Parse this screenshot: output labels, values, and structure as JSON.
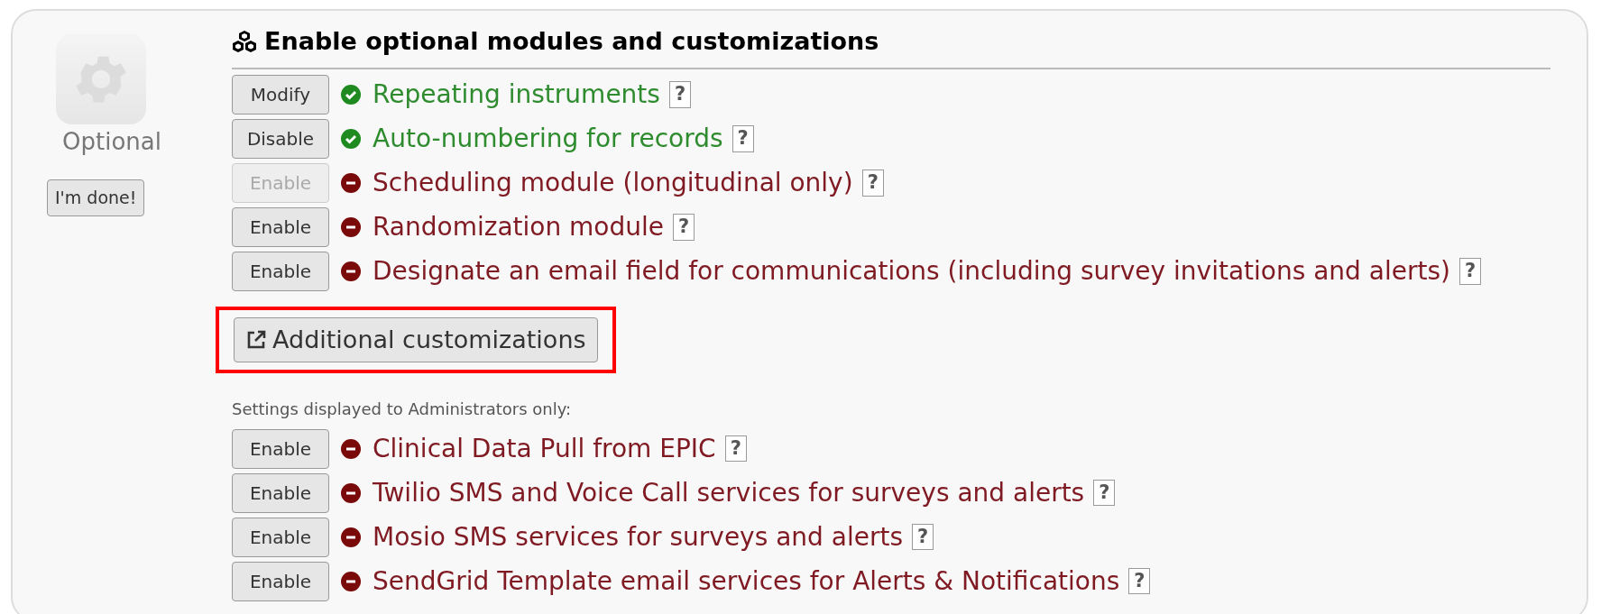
{
  "sidebar": {
    "label": "Optional",
    "done_button": "I'm done!"
  },
  "heading": "Enable optional modules and customizations",
  "modules": [
    {
      "button": "Modify",
      "button_disabled": false,
      "enabled": true,
      "label": "Repeating instruments",
      "help": "?"
    },
    {
      "button": "Disable",
      "button_disabled": false,
      "enabled": true,
      "label": "Auto-numbering for records",
      "help": "?"
    },
    {
      "button": "Enable",
      "button_disabled": true,
      "enabled": false,
      "label": "Scheduling module (longitudinal only)",
      "help": "?"
    },
    {
      "button": "Enable",
      "button_disabled": false,
      "enabled": false,
      "label": "Randomization module",
      "help": "?"
    },
    {
      "button": "Enable",
      "button_disabled": false,
      "enabled": false,
      "label": "Designate an email field for communications (including survey invitations and alerts)",
      "help": "?"
    }
  ],
  "customizations_button": {
    "label": "Additional customizations",
    "highlighted": true
  },
  "admin_note": "Settings displayed to Administrators only:",
  "admin_modules": [
    {
      "button": "Enable",
      "button_disabled": false,
      "enabled": false,
      "label": "Clinical Data Pull from EPIC",
      "help": "?"
    },
    {
      "button": "Enable",
      "button_disabled": false,
      "enabled": false,
      "label": "Twilio SMS and Voice Call services for surveys and alerts",
      "help": "?"
    },
    {
      "button": "Enable",
      "button_disabled": false,
      "enabled": false,
      "label": "Mosio SMS services for surveys and alerts",
      "help": "?"
    },
    {
      "button": "Enable",
      "button_disabled": false,
      "enabled": false,
      "label": "SendGrid Template email services for Alerts & Notifications",
      "help": "?"
    }
  ]
}
